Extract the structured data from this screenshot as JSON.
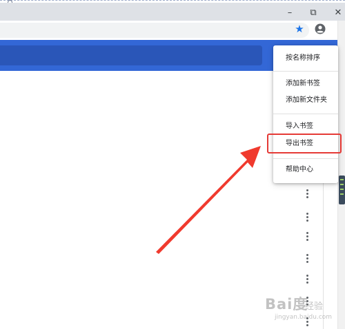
{
  "window_controls": {
    "minimize": "–",
    "restore": "⧉",
    "close": "✕"
  },
  "toolbar": {
    "star_icon": "star-icon",
    "profile_icon": "profile-icon",
    "menu_icon": "more-vert-icon"
  },
  "menu": {
    "items": [
      {
        "label": "按名称排序"
      },
      {
        "label": "添加新书签"
      },
      {
        "label": "添加新文件夹"
      },
      {
        "label": "导入书签"
      },
      {
        "label": "导出书签"
      },
      {
        "label": "帮助中心"
      }
    ]
  },
  "colors": {
    "accent_blue": "#3367d6",
    "highlight_red": "#e53935",
    "star_blue": "#1a73e8"
  },
  "watermark": {
    "logo": "Bai度",
    "cn": "经验",
    "url": "jingyan.baidu.com"
  }
}
